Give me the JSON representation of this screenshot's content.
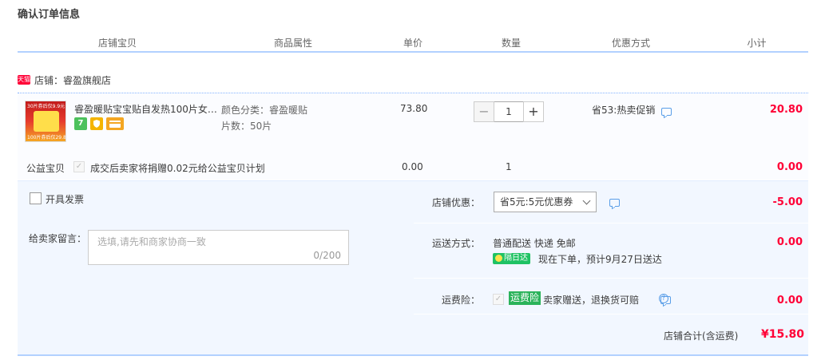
{
  "page": {
    "title": "确认订单信息"
  },
  "columns": [
    "店铺宝贝",
    "商品属性",
    "单价",
    "数量",
    "优惠方式",
    "小计"
  ],
  "shop": {
    "badge": "天猫",
    "label": "店铺：睿盈旗舰店"
  },
  "item": {
    "title": "睿盈暖贴宝宝贴自发热100片女…",
    "thumb_top_text": "30片券后仅9.9元",
    "thumb_bottom_text": "100片券后仅29.8元",
    "badge_seven": "7",
    "attr_color": "颜色分类：睿盈暖贴",
    "attr_count": "片数：50片",
    "price": "73.80",
    "quantity": "1",
    "qty_minus": "−",
    "qty_plus": "+",
    "promo": "省53:热卖促销",
    "subtotal": "20.80"
  },
  "charity": {
    "label": "公益宝贝",
    "text": "成交后卖家将捐赠0.02元给公益宝贝计划",
    "price": "0.00",
    "quantity": "1",
    "subtotal": "0.00"
  },
  "invoice": {
    "label": "开具发票"
  },
  "message": {
    "label": "给卖家留言：",
    "placeholder": "选填,请先和商家协商一致",
    "count": "0/200"
  },
  "coupon": {
    "label": "店铺优惠：",
    "selected": "省5元:5元优惠券",
    "amount": "-5.00"
  },
  "shipping": {
    "label": "运送方式：",
    "method": "普通配送 快递 免邮",
    "next_day_tag": "隔日达",
    "eta": "现在下单，预计9月27日送达",
    "amount": "0.00"
  },
  "insurance": {
    "label": "运费险：",
    "tag": "运费险",
    "text": "卖家赠送，退换货可赔",
    "help": "?",
    "amount": "0.00"
  },
  "total": {
    "label": "店铺合计(含运费)",
    "value": "¥15.80"
  },
  "colors": {
    "accent_red": "#ff0036",
    "header_line": "#b2d1ff",
    "pane_bg": "#f2f7ff",
    "green": "#1fc264"
  }
}
